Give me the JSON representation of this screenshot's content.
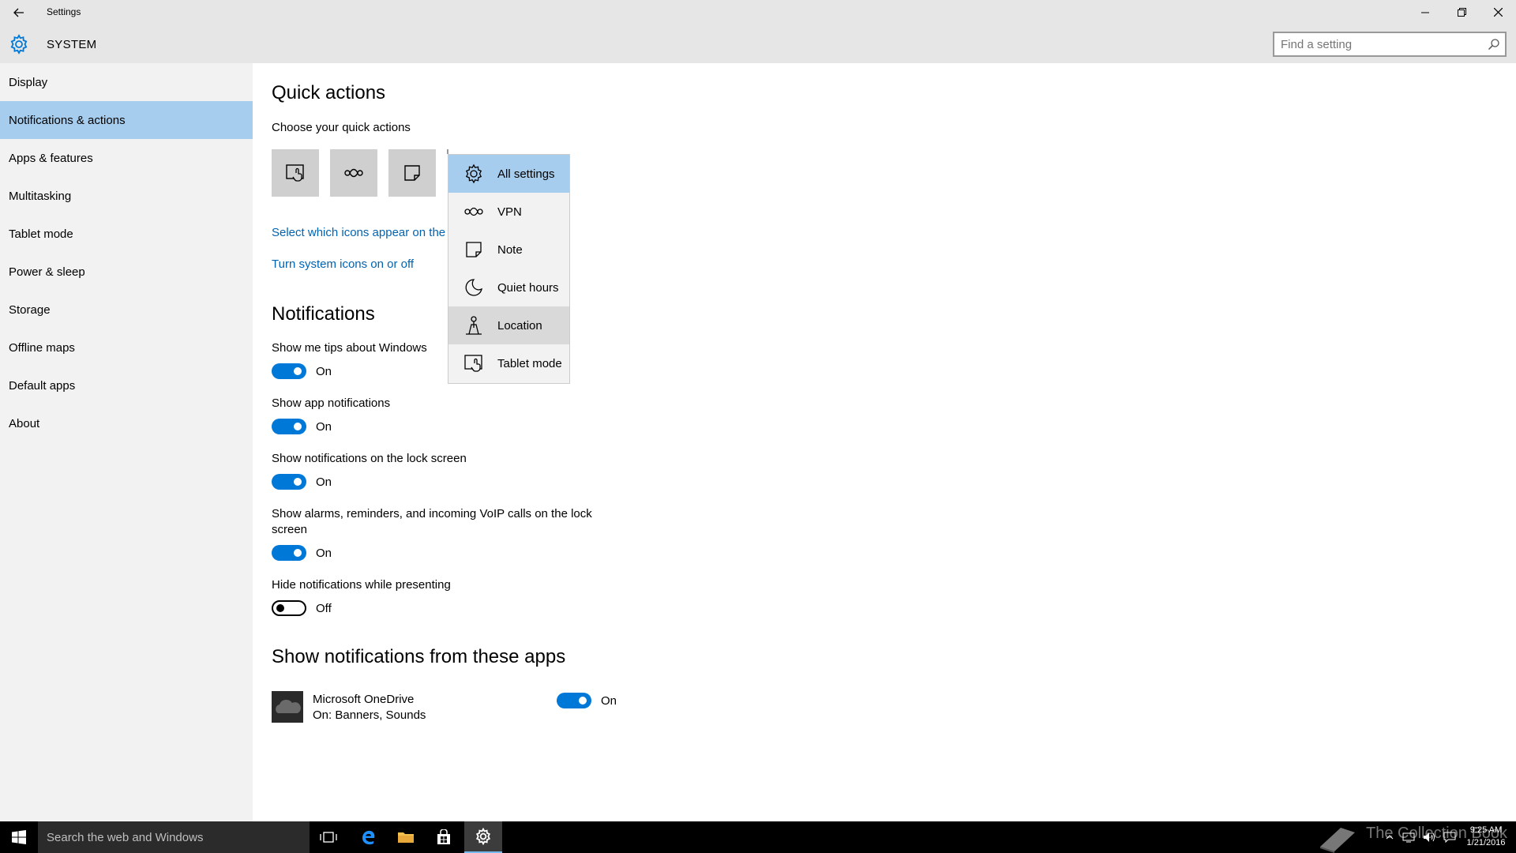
{
  "window": {
    "title": "Settings",
    "header": "SYSTEM",
    "search_placeholder": "Find a setting"
  },
  "sidebar": {
    "items": [
      {
        "label": "Display"
      },
      {
        "label": "Notifications & actions",
        "active": true
      },
      {
        "label": "Apps & features"
      },
      {
        "label": "Multitasking"
      },
      {
        "label": "Tablet mode"
      },
      {
        "label": "Power & sleep"
      },
      {
        "label": "Storage"
      },
      {
        "label": "Offline maps"
      },
      {
        "label": "Default apps"
      },
      {
        "label": "About"
      }
    ]
  },
  "main": {
    "quick_actions_title": "Quick actions",
    "quick_actions_subtitle": "Choose your quick actions",
    "quick_action_tiles": [
      "tablet-mode-icon",
      "vpn-icon",
      "note-icon"
    ],
    "link_select_icons": "Select which icons appear on the",
    "link_system_icons": "Turn system icons on or off",
    "notifications_title": "Notifications",
    "settings": [
      {
        "label": "Show me tips about Windows",
        "state": "On",
        "on": true
      },
      {
        "label": "Show app notifications",
        "state": "On",
        "on": true
      },
      {
        "label": "Show notifications on the lock screen",
        "state": "On",
        "on": true
      },
      {
        "label_line1": "Show alarms, reminders, and incoming VoIP calls on the lock",
        "label_line2": "screen",
        "state": "On",
        "on": true
      },
      {
        "label": "Hide notifications while presenting",
        "state": "Off",
        "on": false
      }
    ],
    "apps_title": "Show notifications from these apps",
    "apps": [
      {
        "name": "Microsoft OneDrive",
        "detail": "On: Banners, Sounds",
        "state": "On",
        "on": true
      }
    ]
  },
  "dropdown": {
    "items": [
      {
        "label": "All settings",
        "icon": "gear-icon",
        "selected": true
      },
      {
        "label": "VPN",
        "icon": "vpn-icon"
      },
      {
        "label": "Note",
        "icon": "note-icon"
      },
      {
        "label": "Quiet hours",
        "icon": "moon-icon"
      },
      {
        "label": "Location",
        "icon": "location-icon",
        "hover": true
      },
      {
        "label": "Tablet mode",
        "icon": "tablet-mode-icon"
      }
    ]
  },
  "taskbar": {
    "search_placeholder": "Search the web and Windows",
    "watermark": "The Collection Book",
    "time": "9:25 AM",
    "date": "1/21/2016"
  },
  "colors": {
    "accent": "#0078d7",
    "link": "#0063b1",
    "selection": "#a6cdee"
  }
}
